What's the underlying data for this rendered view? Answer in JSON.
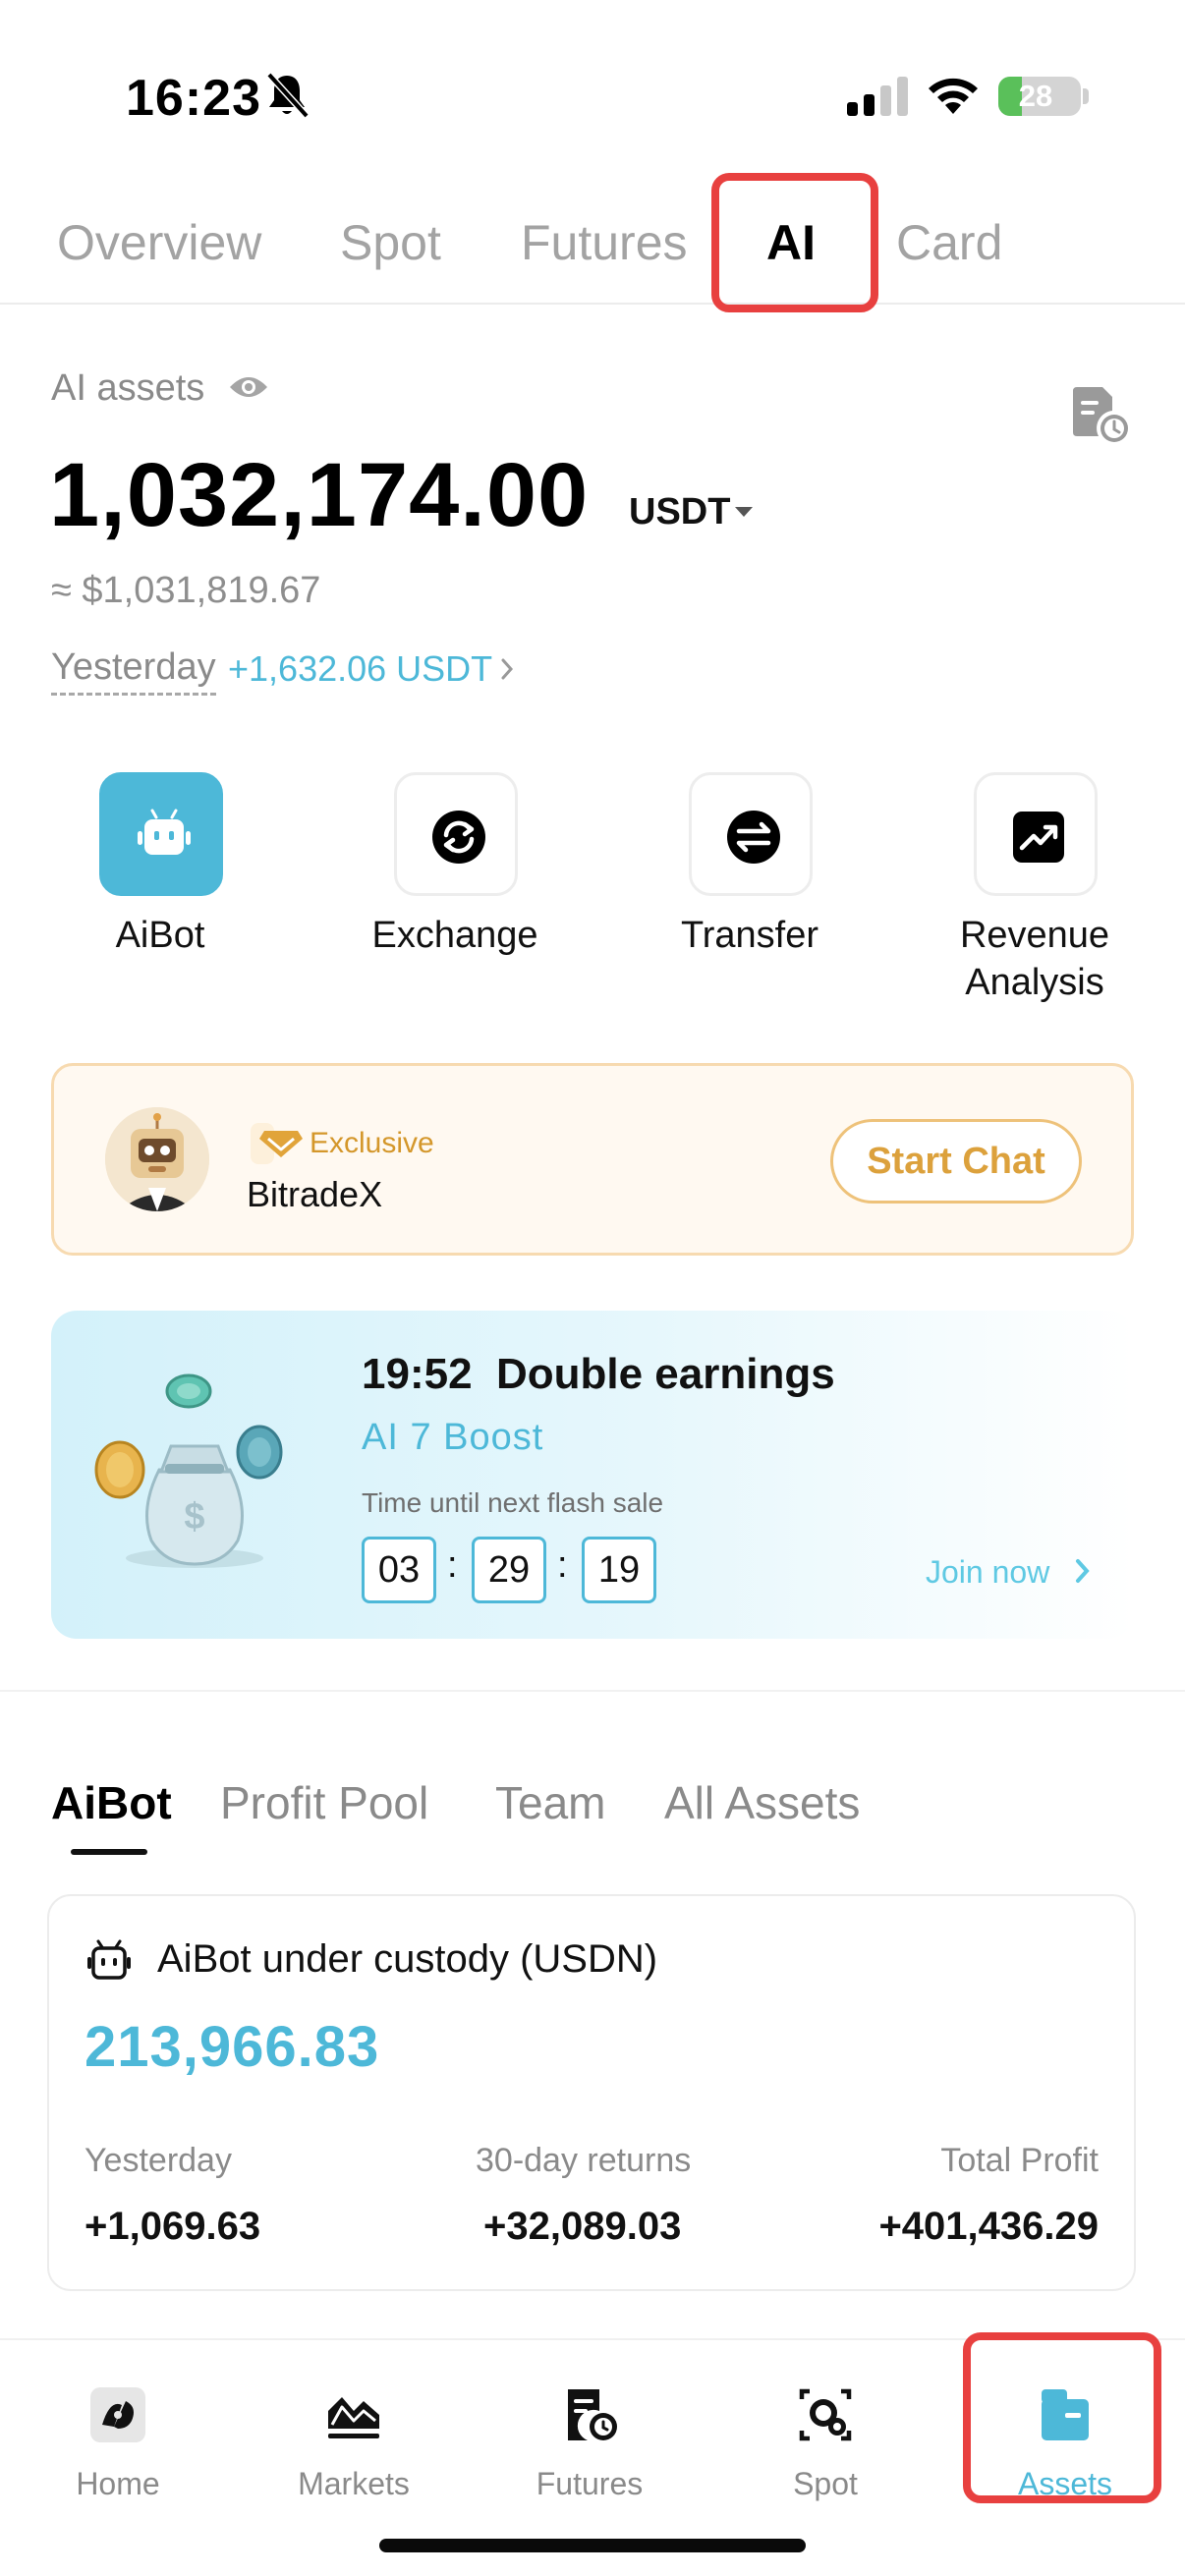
{
  "status_bar": {
    "time": "16:23",
    "battery": "28",
    "battery_fill": 0.28
  },
  "top_tabs": [
    {
      "label": "Overview",
      "active": false
    },
    {
      "label": "Spot",
      "active": false
    },
    {
      "label": "Futures",
      "active": false
    },
    {
      "label": "AI",
      "active": true
    },
    {
      "label": "Card",
      "active": false
    }
  ],
  "assets": {
    "label": "AI assets",
    "value": "1,032,174.00",
    "unit": "USDT",
    "usd_value": "≈ $1,031,819.67",
    "yesterday_label": "Yesterday",
    "yesterday_change": "+1,632.06 USDT"
  },
  "actions": [
    {
      "label": "AiBot",
      "icon": "robot-icon"
    },
    {
      "label": "Exchange",
      "icon": "exchange-icon"
    },
    {
      "label": "Transfer",
      "icon": "transfer-icon"
    },
    {
      "label": "Revenue\nAnalysis",
      "icon": "chart-trend-icon"
    }
  ],
  "chat_card": {
    "badge": "Exclusive",
    "name": "BitradeX",
    "button": "Start Chat"
  },
  "boost": {
    "title": "19:52  Double earnings",
    "subtitle": "AI 7 Boost",
    "hint": "Time until next flash sale",
    "timer": [
      "03",
      "29",
      "19"
    ],
    "separator": ":",
    "join": "Join now"
  },
  "section_tabs": [
    {
      "label": "AiBot",
      "active": true
    },
    {
      "label": "Profit Pool",
      "active": false
    },
    {
      "label": "Team",
      "active": false
    },
    {
      "label": "All Assets",
      "active": false
    }
  ],
  "custody": {
    "title": "AiBot under custody (USDN)",
    "value": "213,966.83",
    "stats": [
      {
        "label": "Yesterday",
        "value": "+1,069.63"
      },
      {
        "label": "30-day returns",
        "value": "+32,089.03"
      },
      {
        "label": "Total Profit",
        "value": "+401,436.29"
      }
    ]
  },
  "bottom_nav": [
    {
      "label": "Home",
      "icon": "home-icon",
      "active": false
    },
    {
      "label": "Markets",
      "icon": "markets-icon",
      "active": false
    },
    {
      "label": "Futures",
      "icon": "futures-icon",
      "active": false
    },
    {
      "label": "Spot",
      "icon": "spot-icon",
      "active": false
    },
    {
      "label": "Assets",
      "icon": "assets-icon",
      "active": true
    }
  ],
  "colors": {
    "accent": "#4db8d8",
    "highlight": "#e8403f",
    "gold": "#dca13c"
  }
}
